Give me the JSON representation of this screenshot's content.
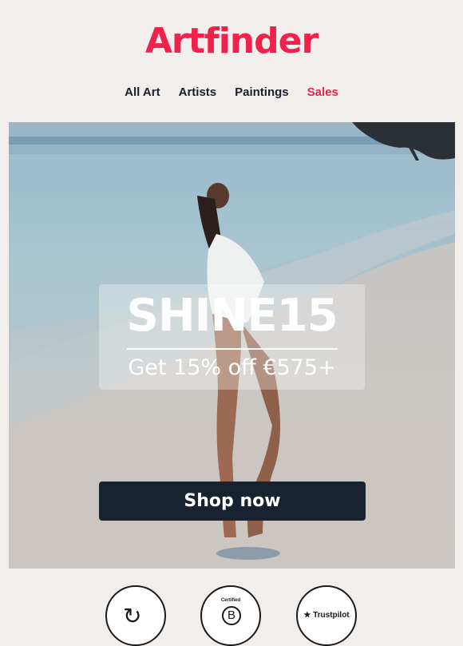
{
  "brand": {
    "logo": "Artfinder",
    "color": "#f2214b"
  },
  "nav": {
    "items": [
      "All Art",
      "Artists",
      "Paintings",
      "Sales"
    ]
  },
  "hero": {
    "promo_code": "SHINE15",
    "promo_text": "Get 15% off €575+",
    "cta": "Shop now"
  },
  "badges": {
    "certified": "Certified",
    "b_corp": "B",
    "trustpilot": "★ Trustpilot"
  }
}
